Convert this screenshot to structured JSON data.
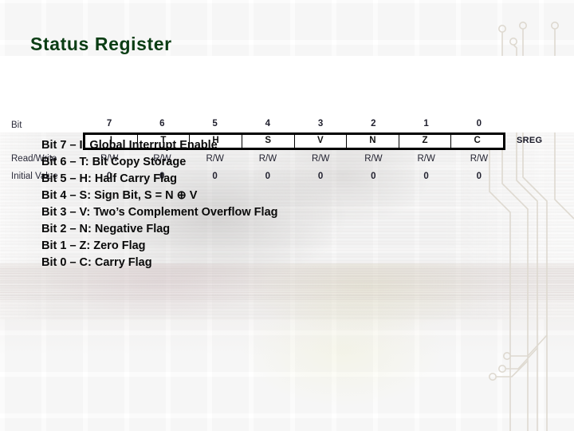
{
  "slide": {
    "title": "Status Register",
    "title_color": "#0b3d14",
    "background_color": "#ffffff"
  },
  "figure": {
    "row_labels": {
      "bit": "Bit",
      "read_write": "Read/Write",
      "initial_value": "Initial Value"
    },
    "register_name": "SREG",
    "bit_numbers": [
      "7",
      "6",
      "5",
      "4",
      "3",
      "2",
      "1",
      "0"
    ],
    "flag_names": [
      "I",
      "T",
      "H",
      "S",
      "V",
      "N",
      "Z",
      "C"
    ],
    "read_write": [
      "R/W",
      "R/W",
      "R/W",
      "R/W",
      "R/W",
      "R/W",
      "R/W",
      "R/W"
    ],
    "initial_values": [
      "0",
      "0",
      "0",
      "0",
      "0",
      "0",
      "0",
      "0"
    ]
  },
  "bit_descriptions": [
    "Bit 7 – I: Global Interrupt Enable",
    "Bit 6 – T: Bit Copy Storage",
    "Bit 5 – H: Half Carry Flag",
    "Bit 4 – S: Sign Bit, S = N ⊕ V",
    "Bit 3 – V: Two’s Complement Overflow Flag",
    "Bit 2 – N: Negative Flag",
    "Bit 1 – Z: Zero Flag",
    "Bit 0 – C: Carry Flag"
  ]
}
